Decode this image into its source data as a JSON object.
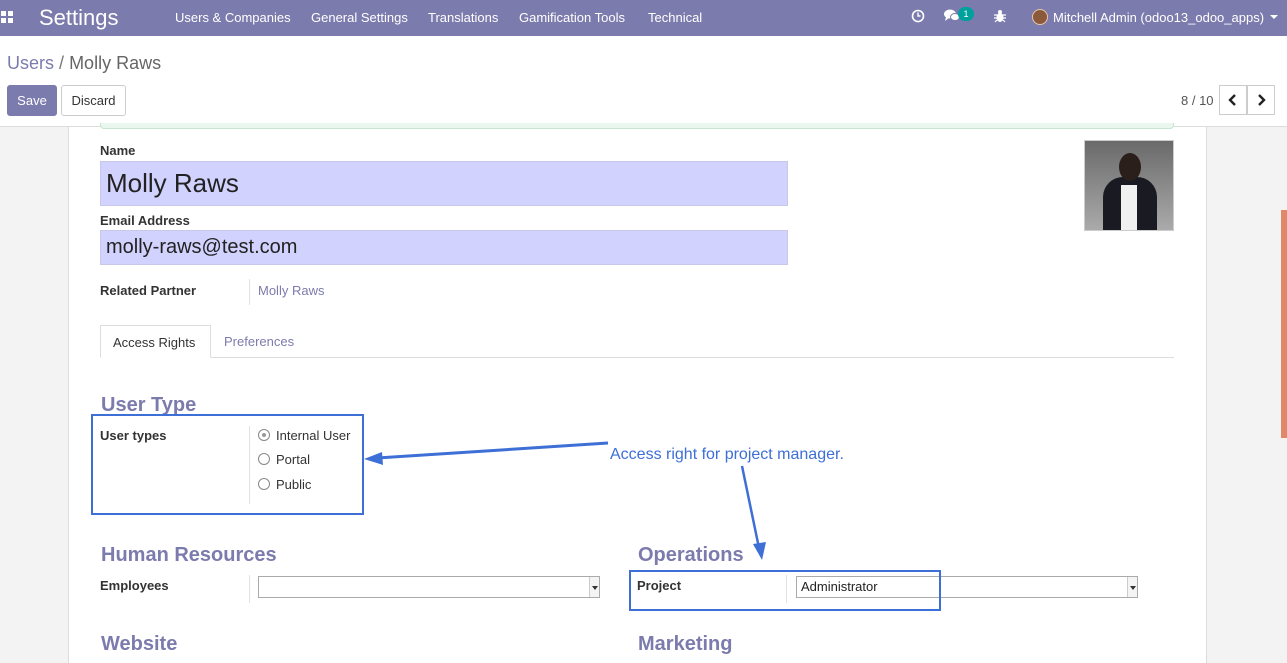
{
  "navbar": {
    "brand": "Settings",
    "menu": [
      "Users & Companies",
      "General Settings",
      "Translations",
      "Gamification Tools",
      "Technical"
    ],
    "messages_count": "1",
    "user": "Mitchell Admin (odoo13_odoo_apps)",
    "icons": [
      "apps-icon",
      "clock-icon",
      "chat-icon",
      "bug-icon"
    ],
    "accent_color": "#7c7bad"
  },
  "control_panel": {
    "breadcrumb_parent": "Users",
    "breadcrumb_separator": "/",
    "breadcrumb_current": "Molly Raws",
    "save_label": "Save",
    "discard_label": "Discard",
    "pager": "8 / 10"
  },
  "form": {
    "name_label": "Name",
    "name_value": "Molly Raws",
    "email_label": "Email Address",
    "email_value": "molly-raws@test.com",
    "partner_label": "Related Partner",
    "partner_value": "Molly Raws",
    "tabs": [
      "Access Rights",
      "Preferences"
    ],
    "user_type": {
      "title": "User Type",
      "label": "User types",
      "options": [
        "Internal User",
        "Portal",
        "Public"
      ],
      "selected": "Internal User"
    },
    "hr": {
      "title": "Human Resources",
      "employees_label": "Employees",
      "employees_value": ""
    },
    "operations": {
      "title": "Operations",
      "project_label": "Project",
      "project_value": "Administrator"
    },
    "website_title": "Website",
    "marketing_title": "Marketing"
  },
  "annotation": {
    "text": "Access right for project manager.",
    "color": "#3d6fd6"
  }
}
